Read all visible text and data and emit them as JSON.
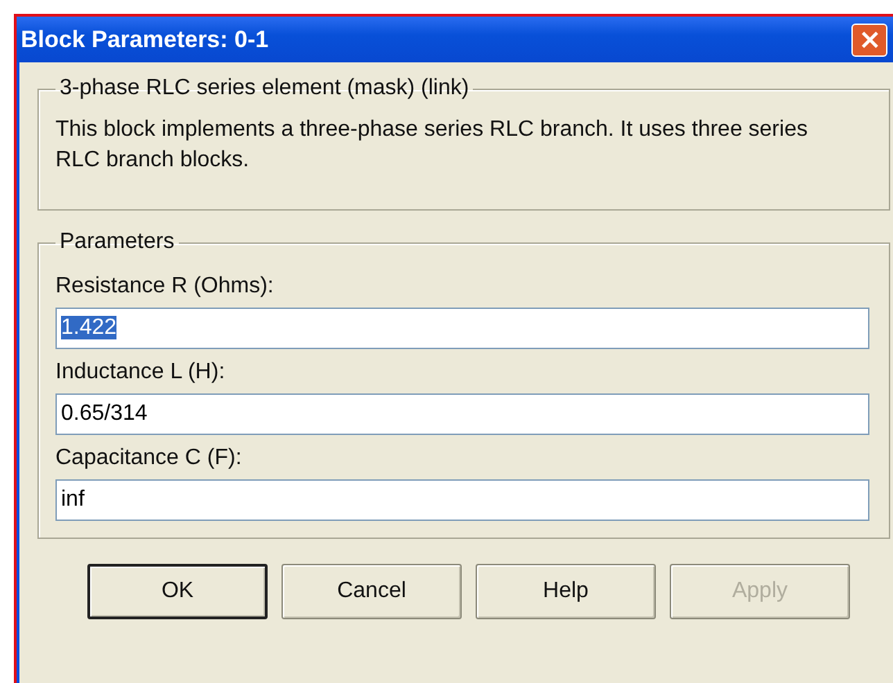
{
  "window": {
    "title": "Block Parameters: 0-1",
    "close": "×"
  },
  "description_group": {
    "title": "3-phase RLC series element (mask) (link)",
    "text": "This block implements a three-phase series RLC branch. It uses three series RLC branch blocks."
  },
  "parameters_group": {
    "title": "Parameters",
    "fields": [
      {
        "label": "Resistance R (Ohms):",
        "value": "1.422",
        "text_selected": true
      },
      {
        "label": "Inductance L (H):",
        "value": "0.65/314",
        "text_selected": false
      },
      {
        "label": "Capacitance C (F):",
        "value": "inf",
        "text_selected": false
      }
    ]
  },
  "buttons": [
    {
      "label": "OK",
      "default": true,
      "disabled": false
    },
    {
      "label": "Cancel",
      "default": false,
      "disabled": false
    },
    {
      "label": "Help",
      "default": false,
      "disabled": false
    },
    {
      "label": "Apply",
      "default": false,
      "disabled": true
    }
  ]
}
